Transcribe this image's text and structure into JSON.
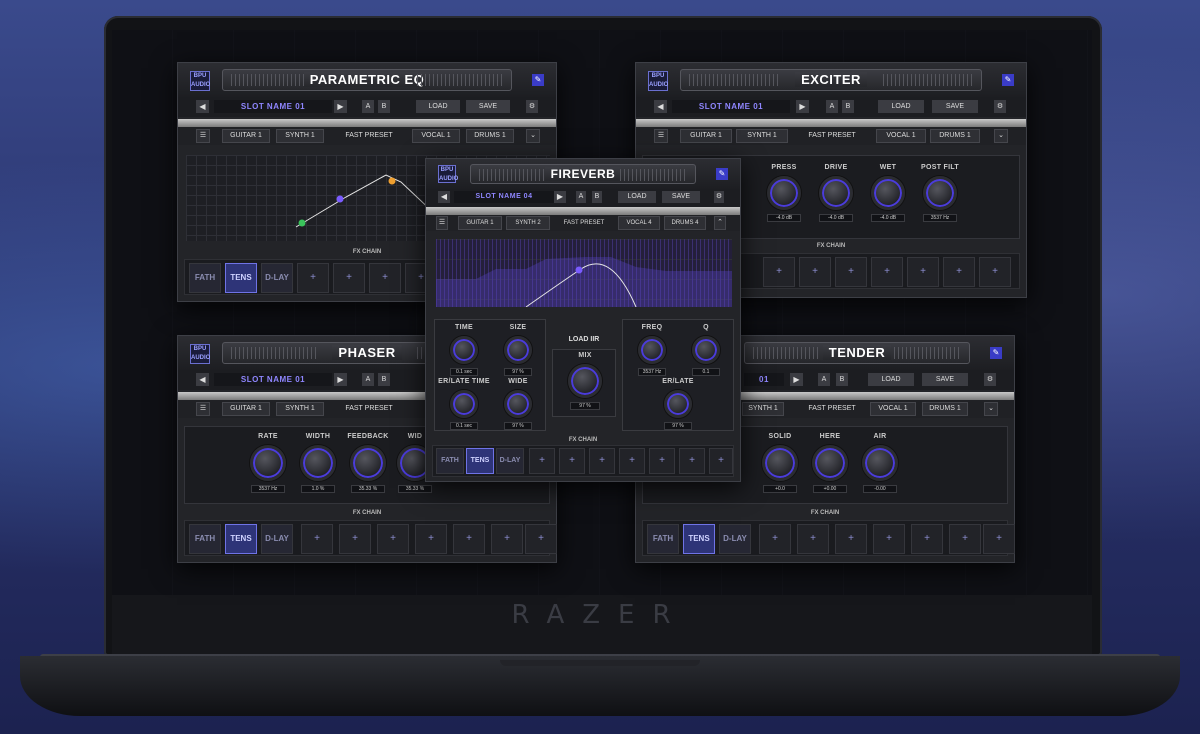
{
  "device": {
    "brand": "RAZER"
  },
  "common": {
    "load": "LOAD",
    "save": "SAVE",
    "a": "A",
    "b": "B",
    "fx_chain": "FX CHAIN",
    "add": "+",
    "logo": "BPU AUDIO"
  },
  "eq": {
    "title": "PARAMETRIC EQ",
    "slot": "SLOT NAME 01",
    "tabs": [
      "GUITAR 1",
      "SYNTH 1",
      "FAST PRESET",
      "VOCAL 1",
      "DRUMS 1"
    ],
    "fx": [
      "FATH",
      "TENS",
      "D-LAY"
    ]
  },
  "exciter": {
    "title": "EXCITER",
    "slot": "SLOT NAME 01",
    "tabs": [
      "GUITAR 1",
      "SYNTH 1",
      "FAST PRESET",
      "VOCAL 1",
      "DRUMS 1"
    ],
    "knobs": [
      {
        "label": "PRESS",
        "value": "-4.0 dB"
      },
      {
        "label": "DRIVE",
        "value": "-4.0 dB"
      },
      {
        "label": "WET",
        "value": "-4.0 dB"
      },
      {
        "label": "POST FILT",
        "value": "3537 Hz"
      }
    ]
  },
  "phaser": {
    "title": "PHASER",
    "slot": "SLOT NAME 01",
    "tabs": [
      "GUITAR 1",
      "SYNTH 1",
      "FAST PRESET"
    ],
    "knobs": [
      {
        "label": "RATE",
        "value": "3537 Hz"
      },
      {
        "label": "WIDTH",
        "value": "1.0 %"
      },
      {
        "label": "FEEDBACK",
        "value": "35.33 %"
      },
      {
        "label": "WID",
        "value": "35.33 %"
      }
    ],
    "fx": [
      "FATH",
      "TENS",
      "D-LAY"
    ]
  },
  "tender": {
    "title": "TENDER",
    "slot": "01",
    "tabs": [
      "SYNTH 1",
      "FAST PRESET",
      "VOCAL 1",
      "DRUMS 1"
    ],
    "knobs": [
      {
        "label": "SOLID",
        "value": "+0.0"
      },
      {
        "label": "HERE",
        "value": "+0.00"
      },
      {
        "label": "AIR",
        "value": "-0.00"
      }
    ],
    "fx": [
      "FATH",
      "TENS",
      "D-LAY"
    ]
  },
  "fireverb": {
    "title": "FIREVERB",
    "slot": "SLOT NAME 04",
    "tabs": [
      "GUITAR 1",
      "SYNTH 2",
      "FAST PRESET",
      "VOCAL 4",
      "DRUMS 4"
    ],
    "load_ir": "LOAD IIR",
    "mix_label": "MIX",
    "mix_value": "97 %",
    "knobs": [
      {
        "label": "TIME",
        "value": "0.1 sec"
      },
      {
        "label": "SIZE",
        "value": "97 %"
      },
      {
        "label": "ER/LATE TIME",
        "value": "0.1 sec"
      },
      {
        "label": "WIDE",
        "value": "97 %"
      },
      {
        "label": "FREQ",
        "value": "3537 Hz"
      },
      {
        "label": "Q",
        "value": "0.1"
      },
      {
        "label": "ER/LATE",
        "value": "97 %"
      }
    ],
    "fx": [
      "FATH",
      "TENS",
      "D-LAY"
    ]
  }
}
